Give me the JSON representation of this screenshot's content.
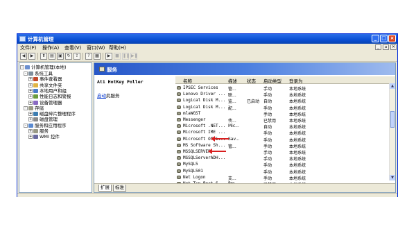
{
  "window": {
    "title": "计算机管理"
  },
  "menu": {
    "items": [
      "文件(F)",
      "操作(A)",
      "查看(V)",
      "窗口(W)",
      "帮助(H)"
    ]
  },
  "tree": {
    "root": "计算机管理(本地)",
    "nodes": [
      {
        "label": "系统工具",
        "level": 1,
        "icon": "tools-icon"
      },
      {
        "label": "事件查看器",
        "level": 2,
        "icon": "event-viewer-icon"
      },
      {
        "label": "共享文件夹",
        "level": 2,
        "icon": "shared-folder-icon"
      },
      {
        "label": "本地用户和组",
        "level": 2,
        "icon": "users-icon"
      },
      {
        "label": "性能日志和警报",
        "level": 2,
        "icon": "performance-icon"
      },
      {
        "label": "设备管理器",
        "level": 2,
        "icon": "device-manager-icon"
      },
      {
        "label": "存储",
        "level": 1,
        "icon": "storage-icon"
      },
      {
        "label": "磁盘碎片整理程序",
        "level": 2,
        "icon": "defrag-icon"
      },
      {
        "label": "磁盘管理",
        "level": 2,
        "icon": "disk-icon"
      },
      {
        "label": "服务和应用程序",
        "level": 1,
        "icon": "services-apps-icon"
      },
      {
        "label": "服务",
        "level": 2,
        "icon": "services-icon"
      },
      {
        "label": "WMI 控件",
        "level": 2,
        "icon": "wmi-icon"
      }
    ]
  },
  "services": {
    "header": "服务",
    "selected_name": "Ati HotKey Poller",
    "start_link": "启动",
    "start_suffix": "此服务",
    "columns": [
      "名称",
      "描述",
      "状态",
      "启动类型",
      "登录为"
    ],
    "rows": [
      [
        "IPSEC Services",
        "管...",
        "",
        "手动",
        "本地系统"
      ],
      [
        "Lenovo Driver ...",
        "联...",
        "",
        "手动",
        "本地系统"
      ],
      [
        "Logical Disk M...",
        "监...",
        "已启动",
        "自动",
        "本地系统"
      ],
      [
        "Logical Disk M...",
        "配...",
        "",
        "手动",
        "本地系统"
      ],
      [
        "mlaWGST",
        "",
        "",
        "手动",
        "本地系统"
      ],
      [
        "Messenger",
        "传...",
        "",
        "已禁用",
        "本地系统"
      ],
      [
        "Microsoft .NET...",
        "Mic...",
        "",
        "自动",
        "本地系统"
      ],
      [
        "Microsoft IME ...",
        "",
        "",
        "手动",
        "本地系统"
      ],
      [
        "Microsoft Offi...",
        "Sav...",
        "",
        "手动",
        "本地系统"
      ],
      [
        "MS Software Sh...",
        "管...",
        "",
        "手动",
        "本地系统"
      ],
      [
        "MSSQLSERVER",
        "",
        "",
        "手动",
        "本地系统"
      ],
      [
        "MSSQLServerADH...",
        "",
        "",
        "手动",
        "本地系统"
      ],
      [
        "MySQL5",
        "",
        "",
        "手动",
        "本地系统"
      ],
      [
        "MySQL501",
        "",
        "",
        "手动",
        "本地系统"
      ],
      [
        "Net Logon",
        "支...",
        "",
        "手动",
        "本地系统"
      ],
      [
        "Net Tcp Port S...",
        "Pro...",
        "",
        "已禁用",
        "本地系统"
      ]
    ],
    "tabs": [
      "扩展",
      "标准"
    ]
  },
  "colors": {
    "titlebar": "#0a4fd4",
    "annotation_arrow": "#d81e1e",
    "header_banner": "#2757c8"
  }
}
